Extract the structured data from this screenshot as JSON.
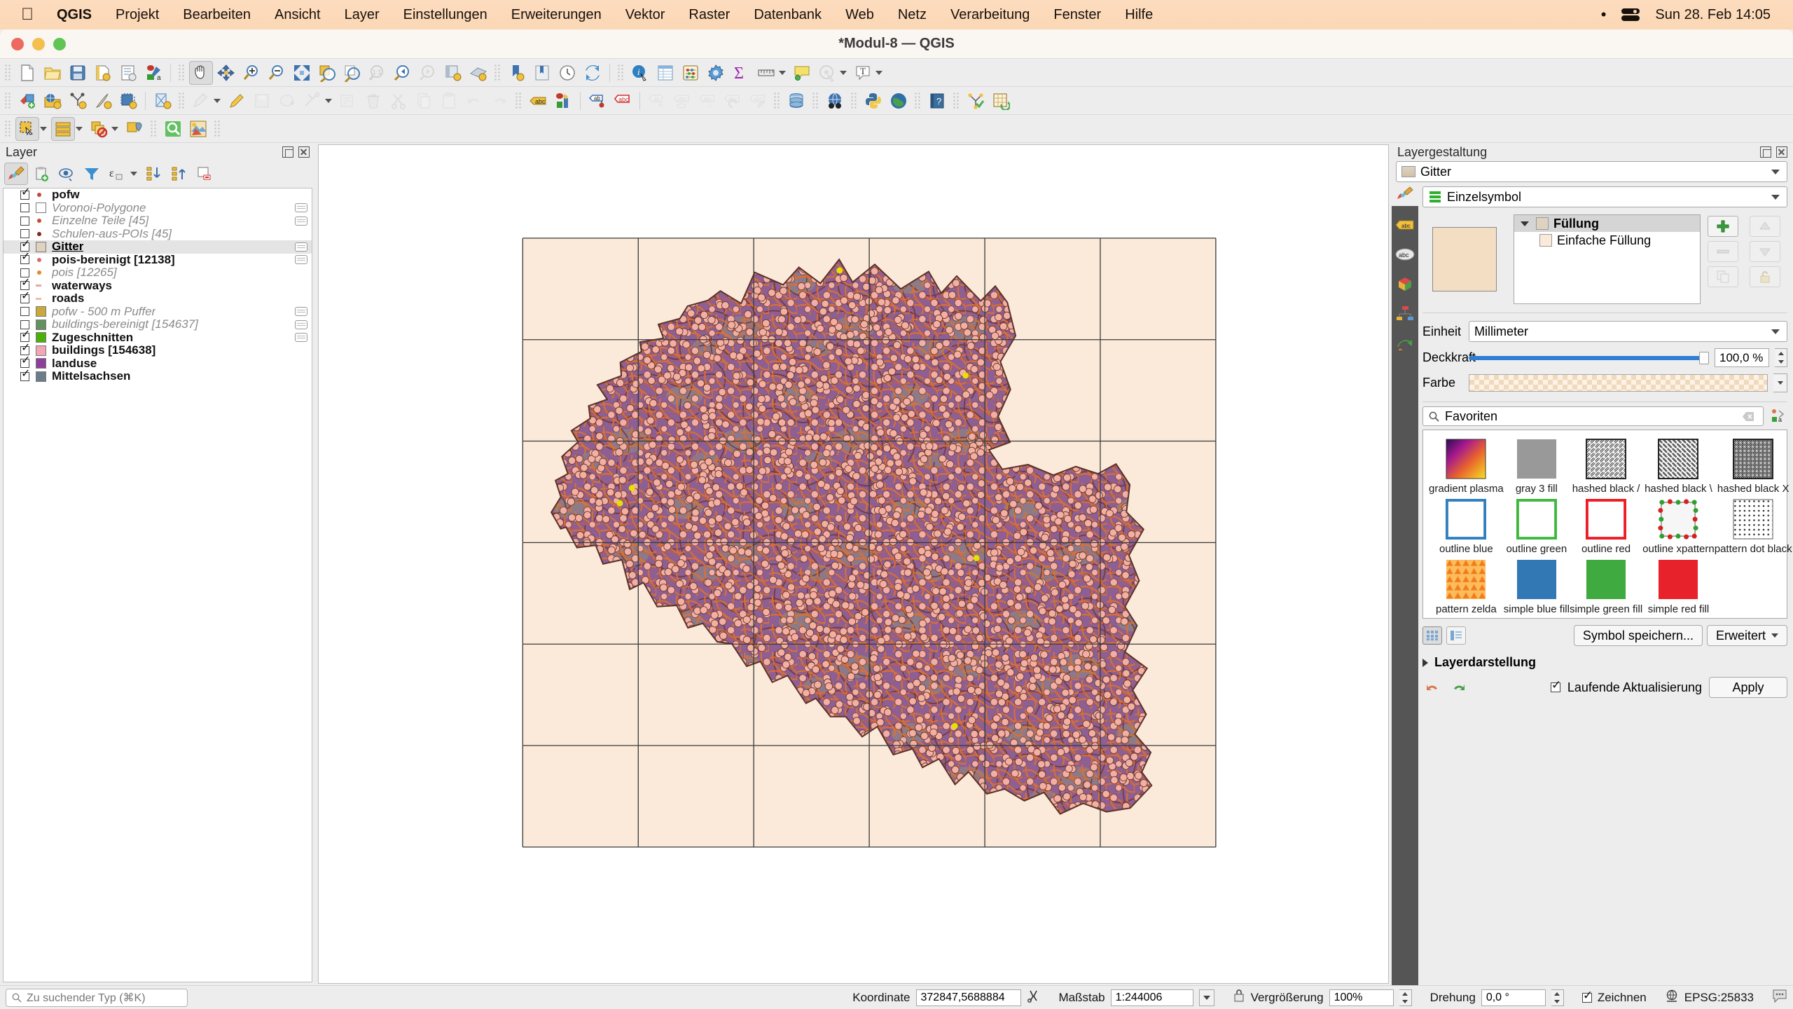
{
  "macbar": {
    "apple_icon": "apple-icon",
    "items": [
      "QGIS",
      "Projekt",
      "Bearbeiten",
      "Ansicht",
      "Layer",
      "Einstellungen",
      "Erweiterungen",
      "Vektor",
      "Raster",
      "Datenbank",
      "Web",
      "Netz",
      "Verarbeitung",
      "Fenster",
      "Hilfe"
    ],
    "status_dot": "•",
    "control_center_icon": "control-center-icon",
    "clock": "Sun 28. Feb  14:05"
  },
  "window": {
    "title": "*Modul-8 — QGIS"
  },
  "toolbars": {
    "row1": [
      {
        "name": "new-project",
        "icon": "page-icon"
      },
      {
        "name": "open-project",
        "icon": "folder-icon"
      },
      {
        "name": "save-project",
        "icon": "floppy-icon"
      },
      {
        "name": "save-project-as",
        "icon": "floppy-gear-icon"
      },
      {
        "name": "new-print-layout",
        "icon": "layout-icon"
      },
      {
        "name": "style-manager",
        "icon": "style-manager-icon"
      },
      {
        "name": "pan-map",
        "icon": "hand-icon",
        "active": true
      },
      {
        "name": "pan-to-selection",
        "icon": "pan-selection-icon"
      },
      {
        "name": "zoom-in",
        "icon": "zoom-in-icon"
      },
      {
        "name": "zoom-out",
        "icon": "zoom-out-icon"
      },
      {
        "name": "zoom-full",
        "icon": "zoom-full-icon"
      },
      {
        "name": "zoom-to-selection",
        "icon": "zoom-selection-icon"
      },
      {
        "name": "zoom-to-layer",
        "icon": "zoom-layer-icon"
      },
      {
        "name": "zoom-native",
        "icon": "zoom-native-icon",
        "disabled": true
      },
      {
        "name": "zoom-last",
        "icon": "zoom-last-icon"
      },
      {
        "name": "zoom-next",
        "icon": "zoom-next-icon",
        "disabled": true
      },
      {
        "name": "new-map-view",
        "icon": "map-view-icon"
      },
      {
        "name": "new-3d-map-view",
        "icon": "map-3d-icon"
      },
      {
        "name": "show-bookmarks",
        "icon": "bookmark-add-icon"
      },
      {
        "name": "show-bookmark-manager",
        "icon": "bookmark-icon"
      },
      {
        "name": "temporal-controller",
        "icon": "clock-icon"
      },
      {
        "name": "refresh",
        "icon": "refresh-icon"
      },
      {
        "name": "identify-features",
        "icon": "identify-icon"
      },
      {
        "name": "open-attribute-table",
        "icon": "table-icon"
      },
      {
        "name": "statistical-summary",
        "icon": "abacus-icon"
      },
      {
        "name": "processing-toolbox",
        "icon": "gear-icon"
      },
      {
        "name": "field-calculator",
        "icon": "sigma-icon"
      },
      {
        "name": "measure-line",
        "icon": "ruler-icon"
      },
      {
        "name": "map-tips",
        "icon": "maptips-icon"
      },
      {
        "name": "show-spatial-bookmarks",
        "icon": "annotation-icon",
        "disabled": true
      },
      {
        "name": "text-annotation",
        "icon": "text-annotation-icon"
      }
    ],
    "row2": [
      {
        "name": "add-vector-layer",
        "icon": "add-vector-icon"
      },
      {
        "name": "add-raster-layer",
        "icon": "add-raster-icon"
      },
      {
        "name": "add-mesh-layer",
        "icon": "add-mesh-icon"
      },
      {
        "name": "add-delimited-text-layer",
        "icon": "add-text-layer-icon"
      },
      {
        "name": "add-postgis-layer",
        "icon": "add-db-icon"
      },
      {
        "name": "add-virtual-layer",
        "icon": "add-virtual-icon"
      },
      {
        "name": "current-edits",
        "icon": "pencil-stack-icon",
        "disabled": true
      },
      {
        "name": "toggle-editing",
        "icon": "pencil-icon"
      },
      {
        "name": "save-layer-edits",
        "icon": "save-edits-icon",
        "disabled": true
      },
      {
        "name": "add-feature",
        "icon": "add-feature-icon",
        "disabled": true
      },
      {
        "name": "vertex-tool",
        "icon": "vertex-tool-icon",
        "disabled": true
      },
      {
        "name": "modify-attributes",
        "icon": "modify-attributes-icon",
        "disabled": true
      },
      {
        "name": "delete-selected",
        "icon": "trash-icon",
        "disabled": true
      },
      {
        "name": "cut-features",
        "icon": "scissors-icon",
        "disabled": true
      },
      {
        "name": "copy-features",
        "icon": "copy-icon",
        "disabled": true
      },
      {
        "name": "paste-features",
        "icon": "paste-icon",
        "disabled": true
      },
      {
        "name": "undo",
        "icon": "undo-icon",
        "disabled": true
      },
      {
        "name": "redo",
        "icon": "redo-icon",
        "disabled": true
      },
      {
        "name": "label-toolbar",
        "icon": "abc-label-icon"
      },
      {
        "name": "layer-styling-panel",
        "icon": "styling-icon"
      },
      {
        "name": "pin-labels",
        "icon": "pin-label-icon"
      },
      {
        "name": "highlight-labels",
        "icon": "highlight-label-icon"
      },
      {
        "name": "move-label",
        "icon": "move-label-icon",
        "disabled": true
      },
      {
        "name": "show-hide-labels",
        "icon": "show-label-icon",
        "disabled": true
      },
      {
        "name": "change-label",
        "icon": "change-label-icon",
        "disabled": true
      },
      {
        "name": "rotate-label",
        "icon": "rotate-label-icon",
        "disabled": true
      },
      {
        "name": "edit-label",
        "icon": "edit-label-icon",
        "disabled": true
      },
      {
        "name": "db-manager",
        "icon": "database-icon"
      },
      {
        "name": "metasearch",
        "icon": "globe-binoculars-icon"
      },
      {
        "name": "python-console",
        "icon": "python-icon"
      },
      {
        "name": "openstreetmap",
        "icon": "globe-icon"
      },
      {
        "name": "help-contents",
        "icon": "help-book-icon"
      },
      {
        "name": "topology-checker",
        "icon": "topology-icon"
      },
      {
        "name": "refresh-table",
        "icon": "table-refresh-icon"
      }
    ],
    "row3": [
      {
        "name": "select-features",
        "icon": "select-rect-icon",
        "active": true
      },
      {
        "name": "select-features-dropdown",
        "icon": "chevron-down-icon"
      },
      {
        "name": "select-by-value",
        "icon": "select-value-icon",
        "active": true
      },
      {
        "name": "select-by-value-dropdown",
        "icon": "chevron-down-icon"
      },
      {
        "name": "deselect-features",
        "icon": "deselect-icon"
      },
      {
        "name": "deselect-dropdown",
        "icon": "chevron-down-icon"
      },
      {
        "name": "select-by-location",
        "icon": "select-location-icon"
      },
      {
        "name": "zoom-selected",
        "icon": "magnifier-green-icon"
      },
      {
        "name": "styling-dock",
        "icon": "paint-icon"
      }
    ]
  },
  "layers_panel": {
    "title": "Layer",
    "float_button": "float-panel-button",
    "close_button": "close-panel-button",
    "toolbar": [
      {
        "name": "open-layer-styling-panel",
        "icon": "brush-icon",
        "active": true
      },
      {
        "name": "add-group",
        "icon": "add-group-icon"
      },
      {
        "name": "manage-layer-visibility",
        "icon": "eye-icon"
      },
      {
        "name": "filter-legend",
        "icon": "funnel-icon"
      },
      {
        "name": "filter-legend-expression",
        "icon": "epsilon-icon"
      },
      {
        "name": "expand-all",
        "icon": "expand-all-icon"
      },
      {
        "name": "collapse-all",
        "icon": "collapse-all-icon"
      },
      {
        "name": "remove-layer",
        "icon": "remove-layer-icon"
      }
    ],
    "layers": [
      {
        "name": "pofw",
        "checked": true,
        "style": "bold",
        "sym": "pt",
        "color": "#c4473f",
        "chip": false
      },
      {
        "name": "Voronoi-Polygone",
        "checked": false,
        "style": "ital",
        "sym": "box",
        "color": "#ffffff",
        "chip": true
      },
      {
        "name": "Einzelne Teile [45]",
        "checked": false,
        "style": "ital",
        "sym": "pt",
        "color": "#c0502f",
        "chip": true
      },
      {
        "name": "Schulen-aus-POIs [45]",
        "checked": false,
        "style": "ital",
        "sym": "pt",
        "color": "#7d2a22",
        "chip": false
      },
      {
        "name": "Gitter",
        "checked": true,
        "style": "sel",
        "sym": "box",
        "color": "#ded3c0",
        "chip": true,
        "selected": true
      },
      {
        "name": "pois-bereinigt [12138]",
        "checked": true,
        "style": "bold",
        "sym": "pt",
        "color": "#d96a6a",
        "chip": true
      },
      {
        "name": "pois [12265]",
        "checked": false,
        "style": "ital",
        "sym": "pt",
        "color": "#e08a2e",
        "chip": false
      },
      {
        "name": "waterways",
        "checked": true,
        "style": "bold",
        "sym": "line",
        "color": "#e7a9a3",
        "chip": false
      },
      {
        "name": "roads",
        "checked": true,
        "style": "bold",
        "sym": "line",
        "color": "#f2b9a8",
        "chip": false
      },
      {
        "name": "pofw - 500 m Puffer",
        "checked": false,
        "style": "ital",
        "sym": "box",
        "color": "#c9a83c",
        "chip": true
      },
      {
        "name": "buildings-bereinigt [154637]",
        "checked": false,
        "style": "ital",
        "sym": "box",
        "color": "#63915f",
        "chip": true
      },
      {
        "name": "Zugeschnitten",
        "checked": true,
        "style": "bold",
        "sym": "box",
        "color": "#4caf07",
        "chip": true
      },
      {
        "name": "buildings [154638]",
        "checked": true,
        "style": "bold",
        "sym": "box",
        "color": "#f3a6b5",
        "chip": false
      },
      {
        "name": "landuse",
        "checked": true,
        "style": "bold",
        "sym": "box",
        "color": "#8d3f9b",
        "chip": false
      },
      {
        "name": "Mittelsachsen",
        "checked": true,
        "style": "bold",
        "sym": "box",
        "color": "#6b7d88",
        "chip": false
      }
    ]
  },
  "style_panel": {
    "title": "Layergestaltung",
    "float_button": "float-panel-button",
    "close_button": "close-panel-button",
    "layer_combo": "Gitter",
    "renderer_combo": "Einzelsymbol",
    "symbol_tree": [
      {
        "label": "Füllung",
        "color": "#ded3c0",
        "level": 0
      },
      {
        "label": "Einfache Füllung",
        "color": "#fbeada",
        "level": 1
      }
    ],
    "preview_color": "#f3dec3",
    "unit_label": "Einheit",
    "unit_value": "Millimeter",
    "opacity_label": "Deckkraft",
    "opacity_value": "100,0 %",
    "color_label": "Farbe",
    "search_value": "Favoriten",
    "library": [
      {
        "label": "gradient  plasma",
        "kind": "gradient-plasma"
      },
      {
        "label": "gray 3 fill",
        "kind": "solid",
        "color": "#999999"
      },
      {
        "label": "hashed black /",
        "kind": "hatch-fwd"
      },
      {
        "label": "hashed black \\",
        "kind": "hatch-back"
      },
      {
        "label": "hashed black X",
        "kind": "hatch-x"
      },
      {
        "label": "outline blue",
        "kind": "outline",
        "color": "#2f7fc1"
      },
      {
        "label": "outline green",
        "kind": "outline",
        "color": "#3fb83f"
      },
      {
        "label": "outline red",
        "kind": "outline",
        "color": "#ed1c24"
      },
      {
        "label": "outline xpattern",
        "kind": "xpattern"
      },
      {
        "label": "pattern dot black",
        "kind": "dots"
      },
      {
        "label": "pattern zelda",
        "kind": "zelda"
      },
      {
        "label": "simple blue fill",
        "kind": "solid",
        "color": "#3278b4"
      },
      {
        "label": "simple green fill",
        "kind": "solid",
        "color": "#3faa3f"
      },
      {
        "label": "simple red fill",
        "kind": "solid",
        "color": "#e8222a"
      }
    ],
    "view_grid_icon": "grid-view-icon",
    "view_list_icon": "list-view-icon",
    "save_symbol_button": "Symbol speichern...",
    "advanced_button": "Erweitert",
    "layer_rendering_section": "Layerdarstellung",
    "undo_icon": "undo-icon",
    "redo_icon": "redo-icon",
    "live_update_label": "Laufende Aktualisierung",
    "live_update_checked": true,
    "apply_button": "Apply"
  },
  "statusbar": {
    "search_placeholder": "Zu suchender Typ (⌘K)",
    "coordinate_label": "Koordinate",
    "coordinate_value": "372847,5688884",
    "toggle_extents_icon": "extent-toggle-icon",
    "scale_label": "Maßstab",
    "scale_value": "1:244006",
    "lock_icon": "lock-icon",
    "magnifier_label": "Vergrößerung",
    "magnifier_value": "100%",
    "rotation_label": "Drehung",
    "rotation_value": "0,0 °",
    "render_label": "Zeichnen",
    "render_checked": true,
    "crs_label": "EPSG:25833",
    "messages_icon": "messages-icon"
  },
  "map": {
    "background": "#ffffff",
    "grid_fill": "#fbeada",
    "grid_line": "#3a3a3a",
    "landuse_fill": "#8d5f93",
    "roads_color": "#e06a2a",
    "waterways_color": "#7a3b2e",
    "buildings_color": "#f3a6a0",
    "green_color": "#8f9d80",
    "poi_color": "#f3b0a2",
    "pofw_color": "#e8e000"
  }
}
